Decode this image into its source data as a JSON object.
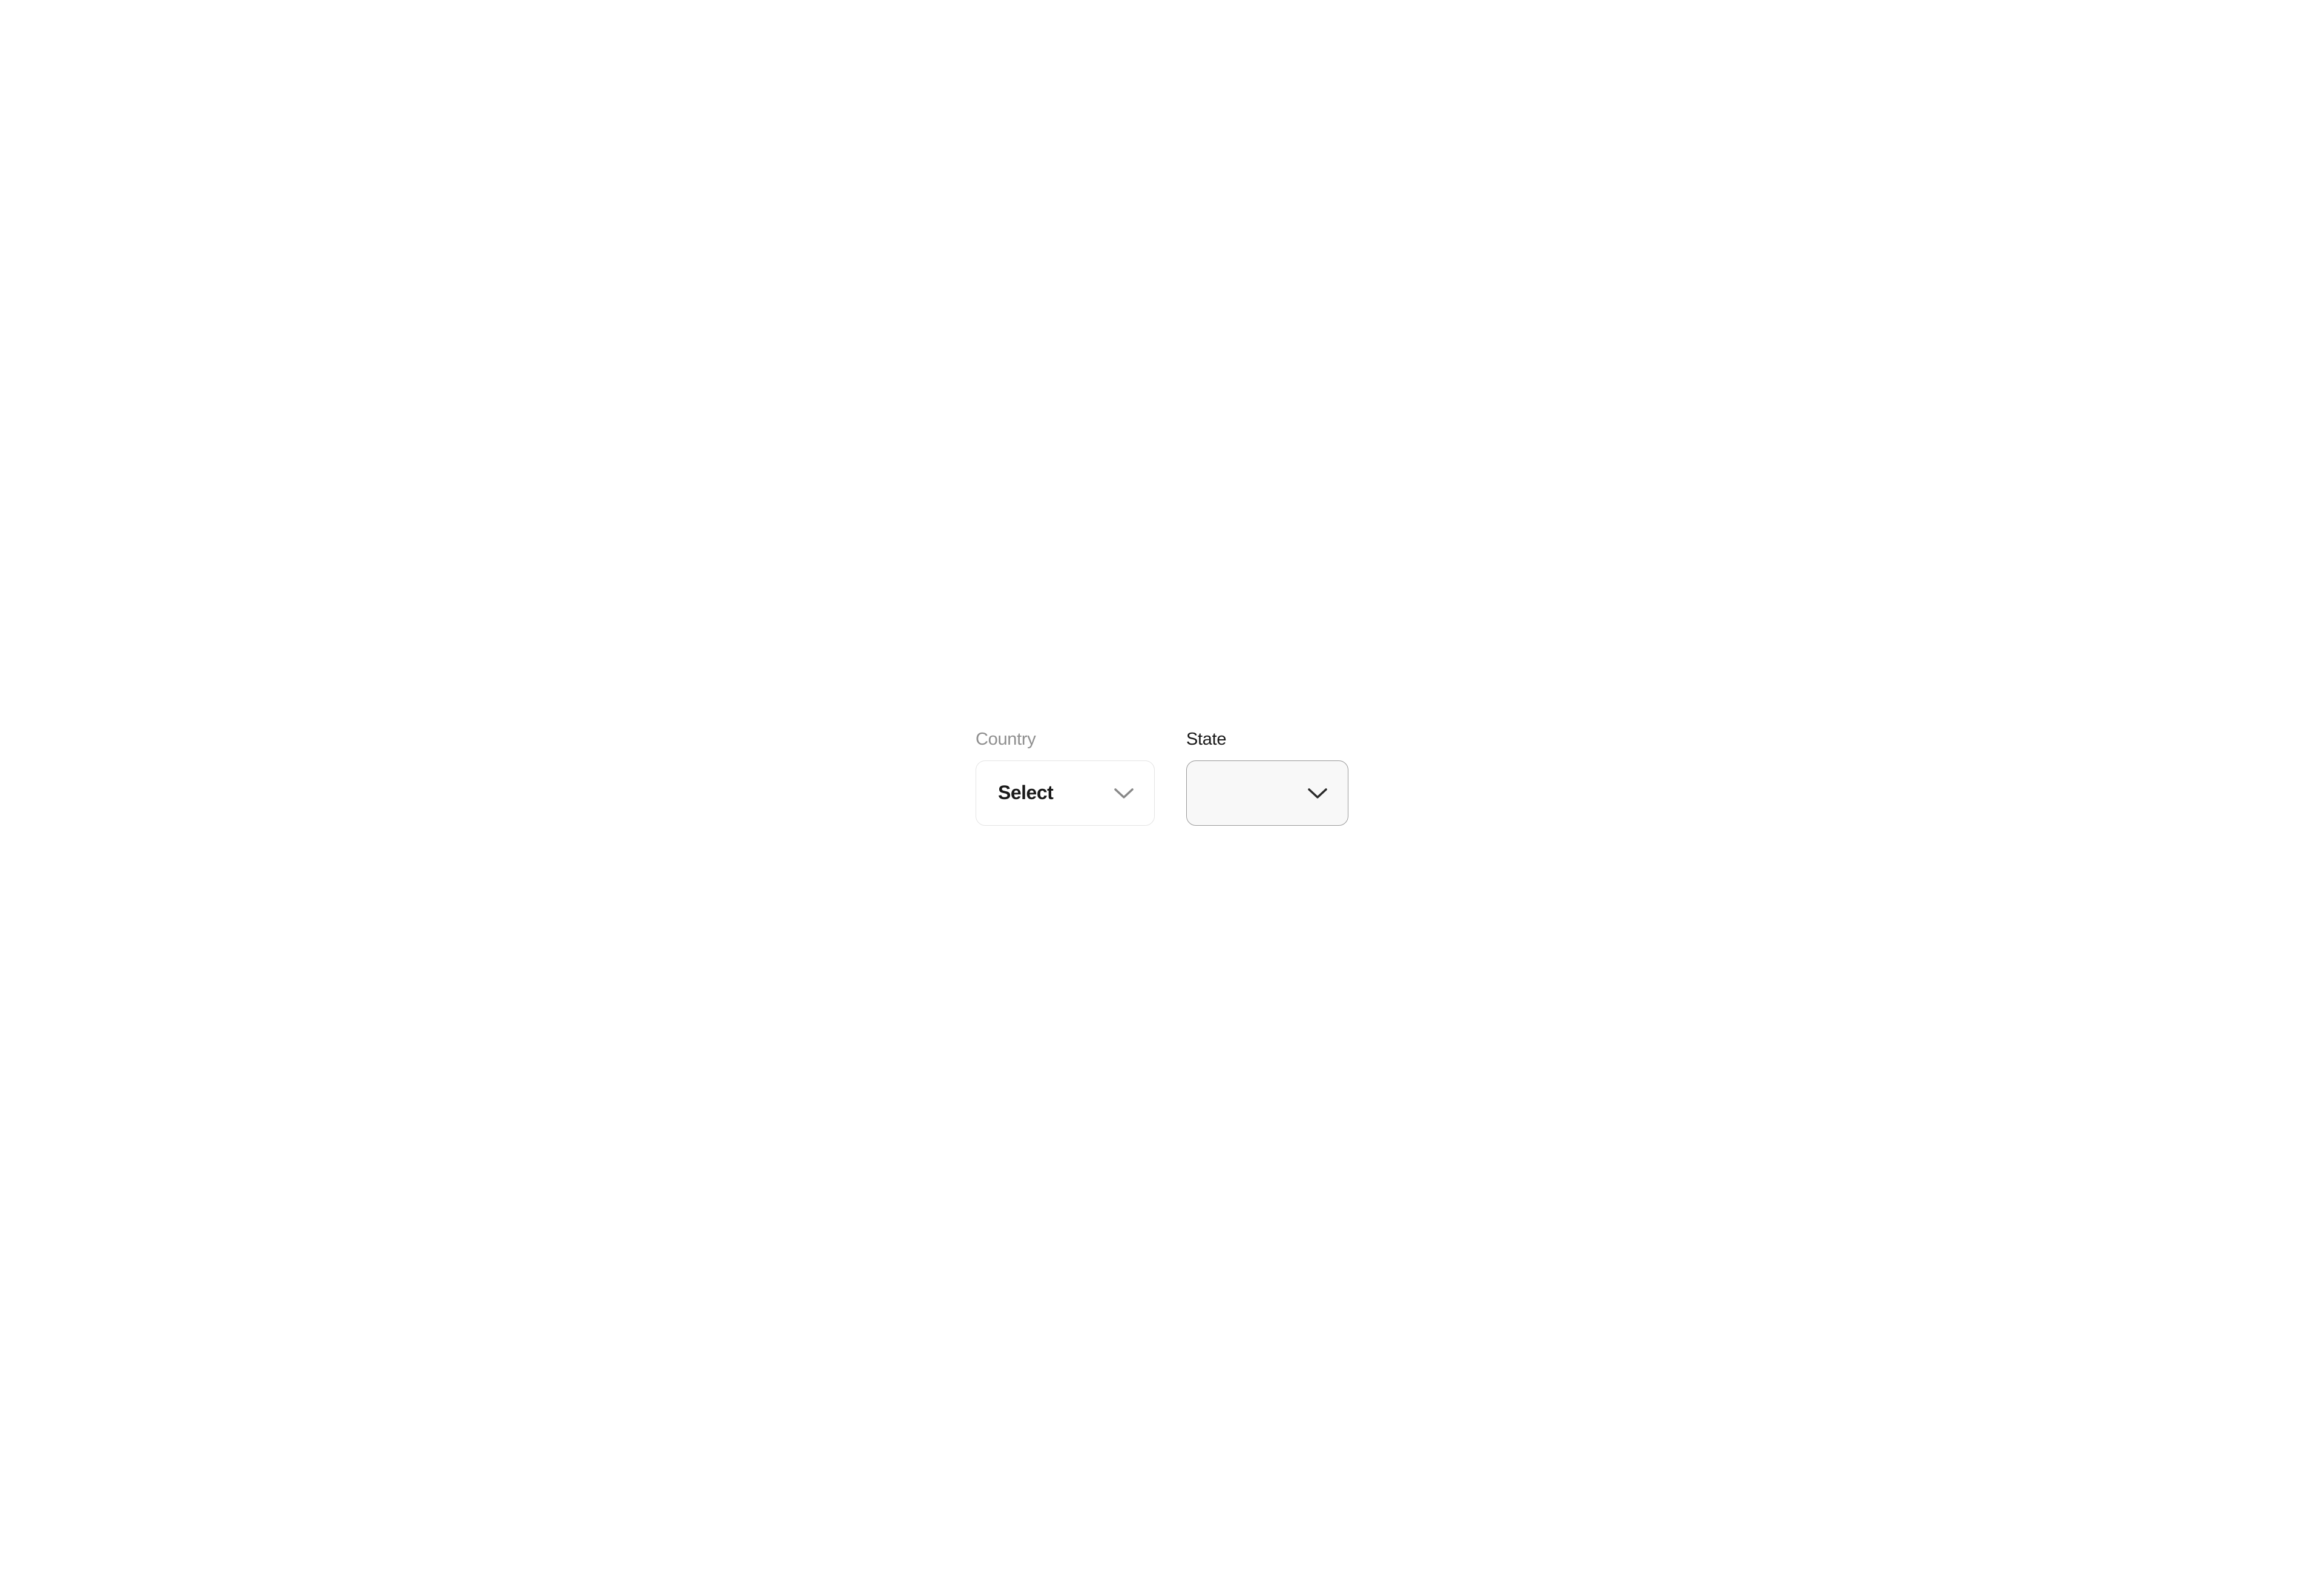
{
  "form": {
    "country": {
      "label": "Country",
      "selected": "Select"
    },
    "state": {
      "label": "State",
      "selected": ""
    }
  }
}
